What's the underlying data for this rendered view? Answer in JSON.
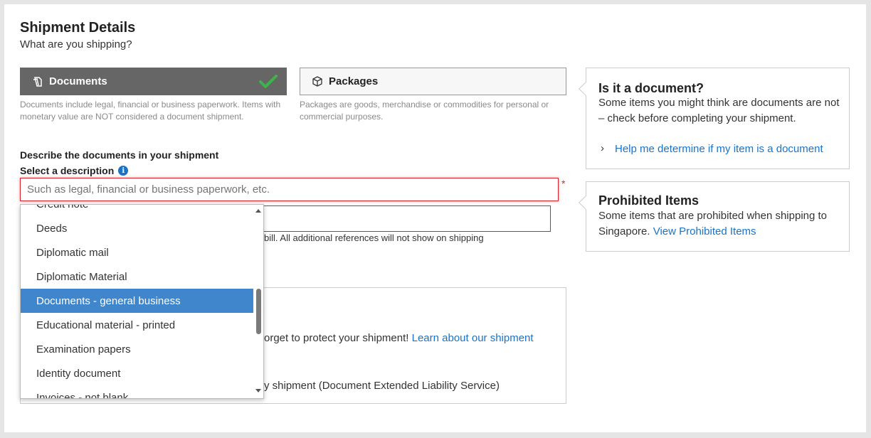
{
  "header": {
    "title": "Shipment Details",
    "subtitle": "What are you shipping?"
  },
  "shipment_types": [
    {
      "label": "Documents",
      "description": "Documents include legal, financial or business paperwork. Items with monetary value are NOT considered a document shipment.",
      "selected": true
    },
    {
      "label": "Packages",
      "description": "Packages are goods, merchandise or commodities for personal or commercial purposes.",
      "selected": false
    }
  ],
  "form": {
    "describe_heading": "Describe the documents in your shipment",
    "select_label": "Select a description",
    "search_placeholder": "Such as legal, financial or business paperwork, etc.",
    "required_mark": "*",
    "reference_note": "bill. All additional references will not show on shipping"
  },
  "dropdown": {
    "items": [
      "Credit note",
      "Deeds",
      "Diplomatic mail",
      "Diplomatic Material",
      "Documents - general business",
      "Educational material - printed",
      "Examination papers",
      "Identity document",
      "Invoices - not blank"
    ],
    "selected_index": 4
  },
  "protection": {
    "text_prefix": "orget to protect your shipment!",
    "link": "Learn about our shipment",
    "option_text": "y shipment (Document Extended Liability Service)"
  },
  "sidebar": {
    "document_box": {
      "title": "Is it a document?",
      "text": "Some items you might think are documents are not – check before completing your shipment.",
      "link": "Help me determine if my item is a document"
    },
    "prohibited_box": {
      "title": "Prohibited Items",
      "text": "Some items that are prohibited when shipping to Singapore.",
      "link": "View Prohibited Items"
    }
  },
  "colors": {
    "selected_button": "#666666",
    "error_red": "#d9232e",
    "link_blue": "#1a73c8",
    "dropdown_highlight": "#3f86cc",
    "check_green": "#3bb54a"
  }
}
